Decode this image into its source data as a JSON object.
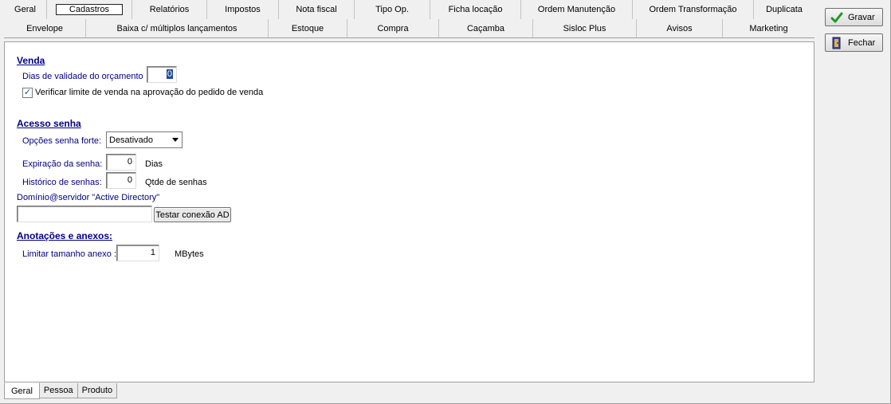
{
  "tabs_row1": [
    {
      "label": "Geral",
      "selected": false
    },
    {
      "label": "Cadastros",
      "selected": true
    },
    {
      "label": "Relatórios",
      "selected": false
    },
    {
      "label": "Impostos",
      "selected": false
    },
    {
      "label": "Nota fiscal",
      "selected": false
    },
    {
      "label": "Tipo Op.",
      "selected": false
    },
    {
      "label": "Ficha locação",
      "selected": false
    },
    {
      "label": "Ordem Manutenção",
      "selected": false
    },
    {
      "label": "Ordem Transformação",
      "selected": false
    },
    {
      "label": "Duplicata",
      "selected": false
    }
  ],
  "tabs_row2": [
    {
      "label": "Envelope"
    },
    {
      "label": "Baixa c/ múltiplos lançamentos"
    },
    {
      "label": "Estoque"
    },
    {
      "label": "Compra"
    },
    {
      "label": "Caçamba"
    },
    {
      "label": "Sisloc Plus"
    },
    {
      "label": "Avisos"
    },
    {
      "label": "Marketing"
    }
  ],
  "venda": {
    "title": "Venda",
    "dias_label": "Dias de validade do orçamento",
    "dias_value": "0",
    "verificar_label": "Verificar limite de venda na aprovação do pedido de venda",
    "verificar_checked": true
  },
  "acesso": {
    "title": "Acesso senha",
    "opcoes_label": "Opções senha forte:",
    "opcoes_value": "Desativado",
    "expiracao_label": "Expiração da senha:",
    "expiracao_value": "0",
    "expiracao_unit": "Dias",
    "historico_label": "Histórico de senhas:",
    "historico_value": "0",
    "historico_unit": "Qtde de senhas",
    "dominio_label": "Domínio@servidor \"Active Directory\"",
    "dominio_value": "",
    "testar_label": "Testar conexão AD"
  },
  "anotacoes": {
    "title": "Anotações e anexos:",
    "limitar_label": "Limitar tamanho anexo :",
    "limitar_value": "1",
    "limitar_unit": "MBytes"
  },
  "side_buttons": {
    "gravar": "Gravar",
    "fechar": "Fechar"
  },
  "bottom_tabs": [
    {
      "label": "Geral",
      "selected": true
    },
    {
      "label": "Pessoa",
      "selected": false
    },
    {
      "label": "Produto",
      "selected": false
    }
  ],
  "colors": {
    "section_title": "#000080",
    "label": "#000080",
    "checkmark_gravar": "#1f9a1f"
  }
}
